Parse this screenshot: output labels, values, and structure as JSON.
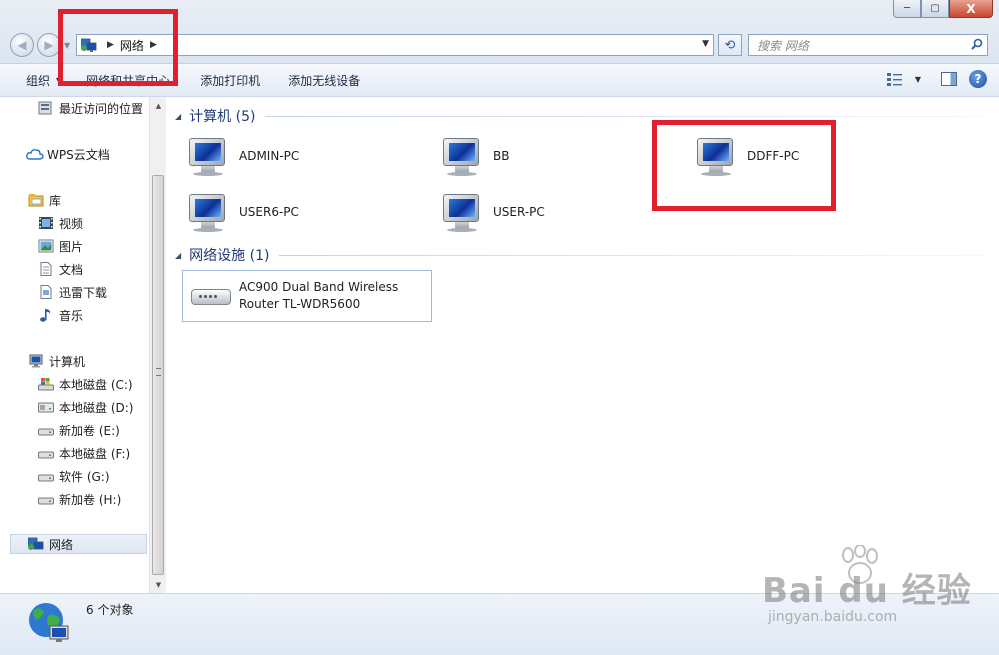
{
  "window": {
    "minimize": "─",
    "maximize": "▢",
    "close": "X"
  },
  "address": {
    "location": "网络",
    "search_placeholder": "搜索 网络"
  },
  "toolbar": {
    "organize": "组织",
    "network_sharing_center": "网络和共享中心",
    "add_printer": "添加打印机",
    "add_wireless_device": "添加无线设备"
  },
  "sidebar": {
    "items": [
      {
        "label": "最近访问的位置",
        "icon": "recent-places-icon"
      },
      {
        "label": "WPS云文档",
        "icon": "cloud-icon"
      },
      {
        "label": "库",
        "icon": "library-icon"
      },
      {
        "label": "视频",
        "icon": "video-icon"
      },
      {
        "label": "图片",
        "icon": "picture-icon"
      },
      {
        "label": "文档",
        "icon": "document-icon"
      },
      {
        "label": "迅雷下载",
        "icon": "download-icon"
      },
      {
        "label": "音乐",
        "icon": "music-icon"
      },
      {
        "label": "计算机",
        "icon": "computer-icon"
      },
      {
        "label": "本地磁盘 (C:)",
        "icon": "system-drive-icon"
      },
      {
        "label": "本地磁盘 (D:)",
        "icon": "drive-icon"
      },
      {
        "label": "新加卷 (E:)",
        "icon": "drive-icon"
      },
      {
        "label": "本地磁盘 (F:)",
        "icon": "drive-icon"
      },
      {
        "label": "软件 (G:)",
        "icon": "drive-icon"
      },
      {
        "label": "新加卷 (H:)",
        "icon": "drive-icon"
      },
      {
        "label": "网络",
        "icon": "network-icon"
      }
    ]
  },
  "content": {
    "computers_group": "计算机 (5)",
    "computers": [
      "ADMIN-PC",
      "BB",
      "DDFF-PC",
      "USER6-PC",
      "USER-PC"
    ],
    "infrastructure_group": "网络设施 (1)",
    "device": {
      "line1": "AC900 Dual Band Wireless",
      "line2": "Router TL-WDR5600"
    }
  },
  "details": {
    "status": "6 个对象"
  },
  "watermark": {
    "brand": "Bai du 经验",
    "url": "jingyan.baidu.com"
  },
  "colors": {
    "highlight": "#e0202e",
    "group_title": "#1e3a7b"
  }
}
